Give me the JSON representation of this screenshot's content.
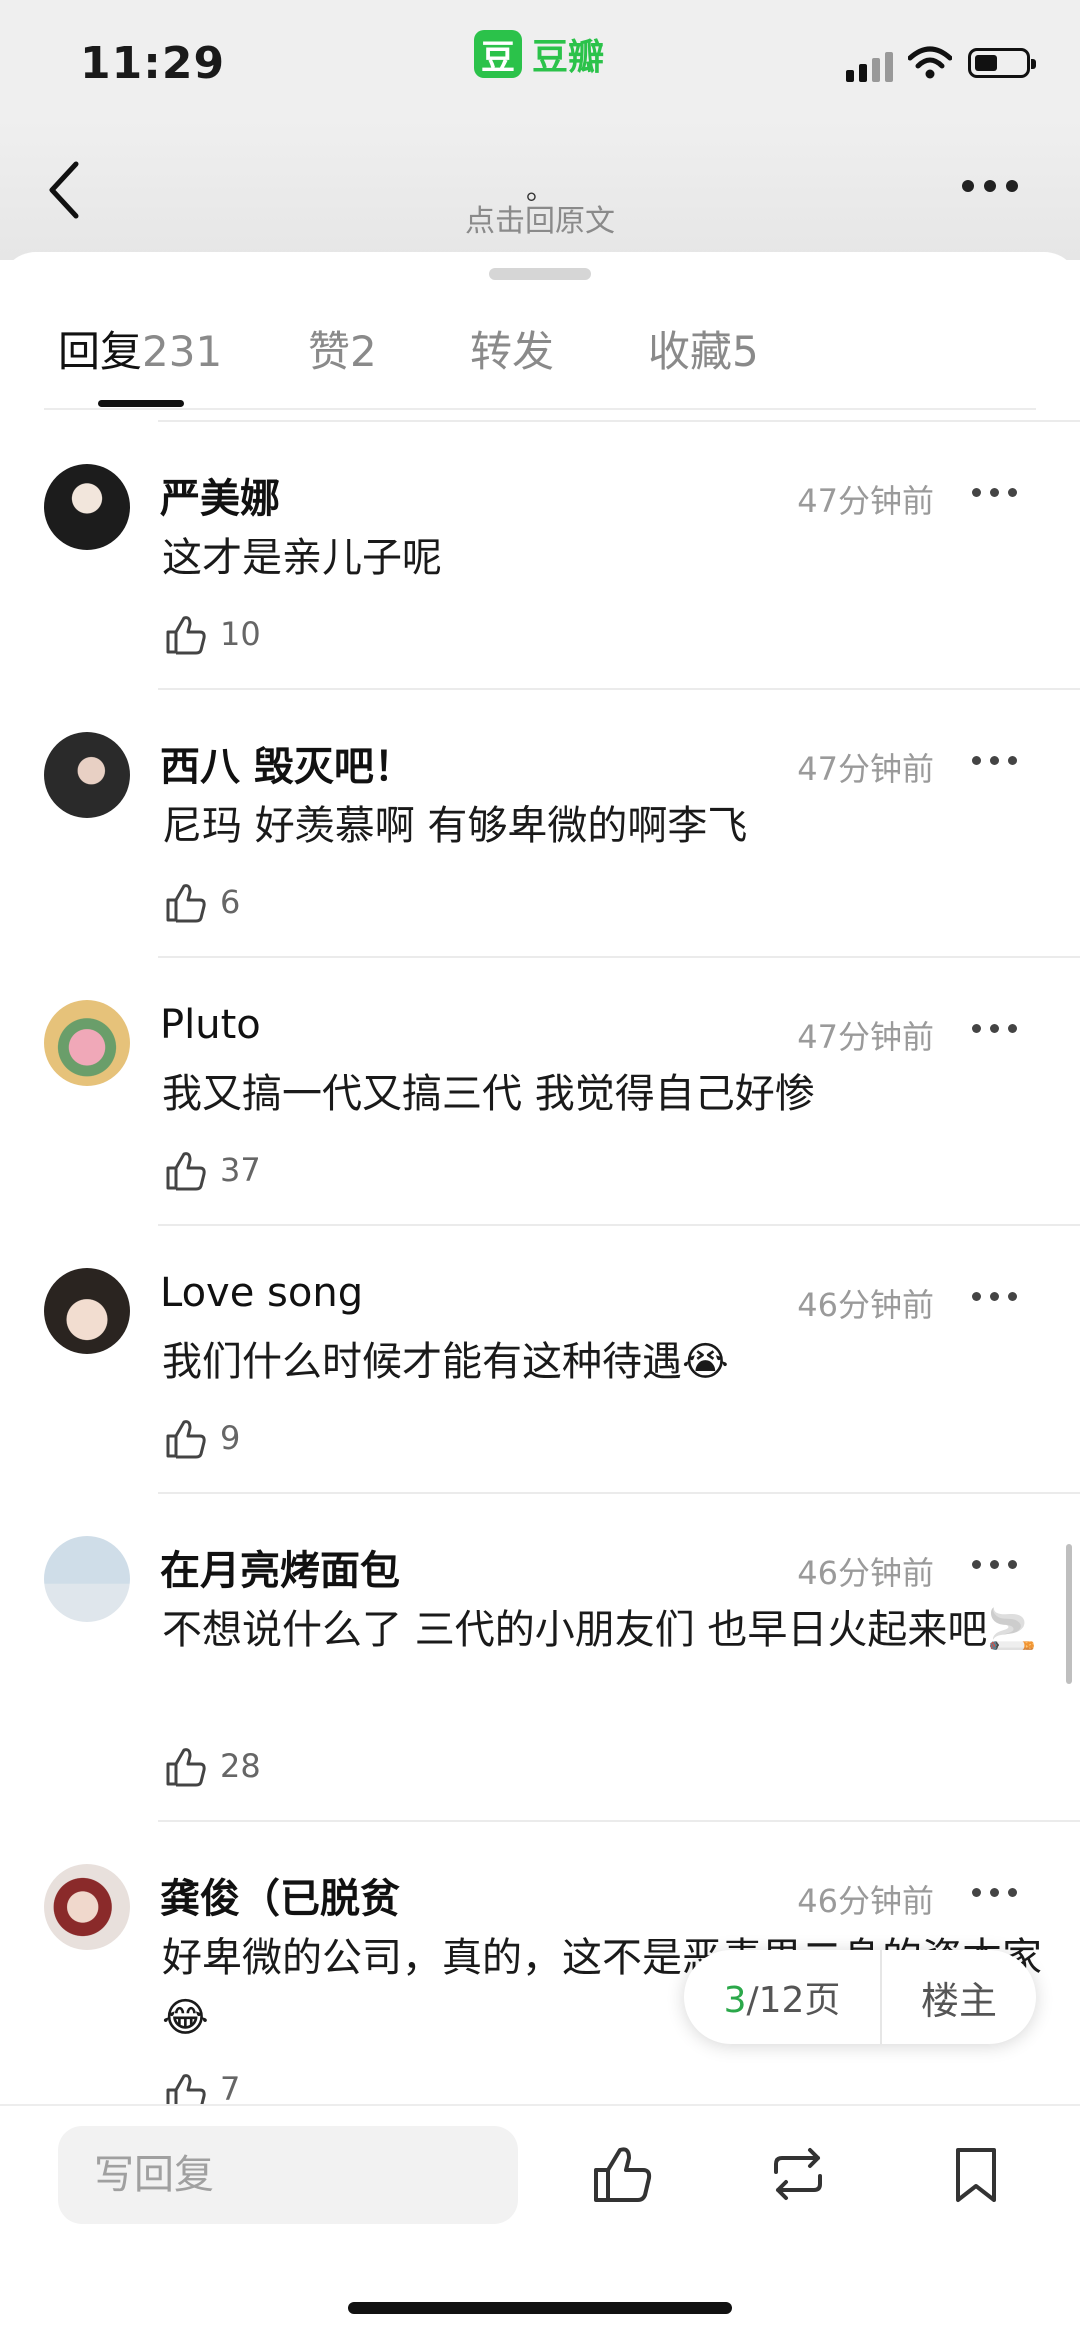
{
  "status": {
    "time": "11:29",
    "app_name": "豆瓣",
    "app_logo_char": "豆"
  },
  "nav": {
    "title": "。",
    "subtitle": "点击回原文"
  },
  "tabs": [
    {
      "label": "回复",
      "count": "231"
    },
    {
      "label": "赞",
      "count": "2"
    },
    {
      "label": "转发",
      "count": ""
    },
    {
      "label": "收藏",
      "count": "5"
    }
  ],
  "comments": [
    {
      "name": "严美娜",
      "time": "47分钟前",
      "text": "这才是亲儿子呢",
      "likes": "10"
    },
    {
      "name": "西八 毁灭吧！",
      "time": "47分钟前",
      "text": "尼玛 好羡慕啊 有够卑微的啊李飞",
      "likes": "6"
    },
    {
      "name": "Pluto",
      "time": "47分钟前",
      "text": "我又搞一代又搞三代 我觉得自己好惨",
      "likes": "37"
    },
    {
      "name": "Love song",
      "time": "46分钟前",
      "text": "我们什么时候才能有这种待遇😭",
      "likes": "9"
    },
    {
      "name": "在月亮烤面包",
      "time": "46分钟前",
      "text": "不想说什么了 三代的小朋友们 也早日火起来吧🚬",
      "likes": "28"
    },
    {
      "name": "龚俊（已脱贫",
      "time": "46分钟前",
      "text": "好卑微的公司，真的，这不是恶毒男二身的资本家😂",
      "likes": "7"
    }
  ],
  "pager": {
    "current": "3",
    "total_label": "/12页",
    "op_button": "楼主"
  },
  "bottom": {
    "reply_placeholder": "写回复"
  },
  "colors": {
    "accent": "#2bc24a",
    "page_current": "#2ba84a"
  }
}
